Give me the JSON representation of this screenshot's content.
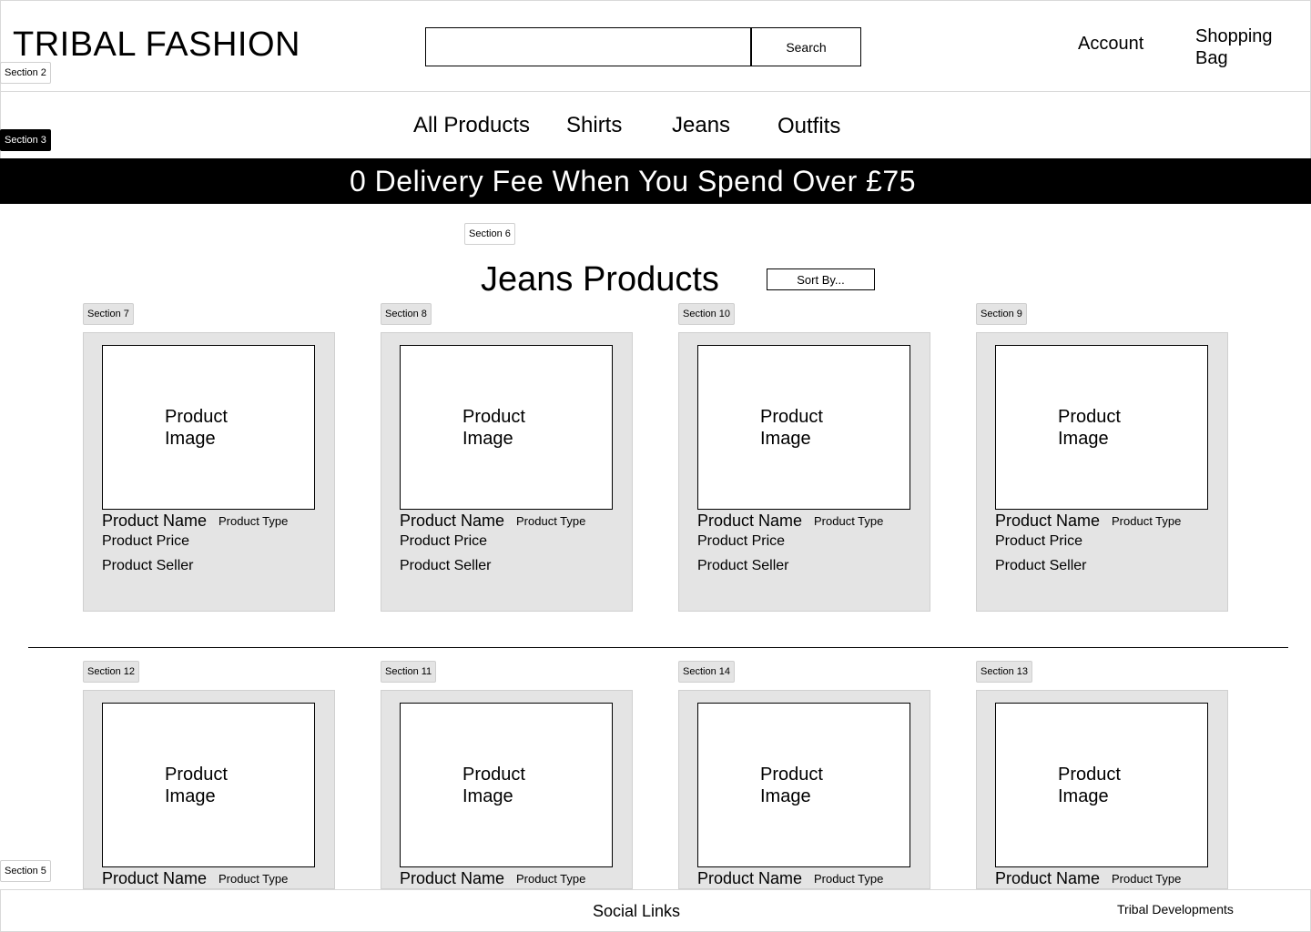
{
  "header": {
    "brand": "TRIBAL FASHION",
    "search_placeholder": "",
    "search_label": "Search",
    "account_label": "Account",
    "bag_label": "Shopping Bag"
  },
  "section_tags": {
    "s2": "Section 2",
    "s3": "Section 3",
    "s5": "Section 5",
    "s6": "Section 6",
    "s7": "Section 7",
    "s8": "Section 8",
    "s9": "Section 9",
    "s10": "Section 10",
    "s11": "Section 11",
    "s12": "Section 12",
    "s13": "Section 13",
    "s14": "Section 14"
  },
  "nav": {
    "items": [
      "All Products",
      "Shirts",
      "Jeans",
      "Outfits"
    ]
  },
  "banner": {
    "text": "0 Delivery Fee When You Spend Over £75"
  },
  "main": {
    "title": "Jeans Products",
    "sort_label": "Sort By..."
  },
  "product_card": {
    "image_label": "Product Image",
    "name": "Product Name",
    "type": "Product Type",
    "price": "Product Price",
    "seller": "Product Seller"
  },
  "footer": {
    "social": "Social Links",
    "developer": "Tribal Developments"
  },
  "colors": {
    "banner_bg": "#000000",
    "card_bg": "#e4e4e4"
  }
}
